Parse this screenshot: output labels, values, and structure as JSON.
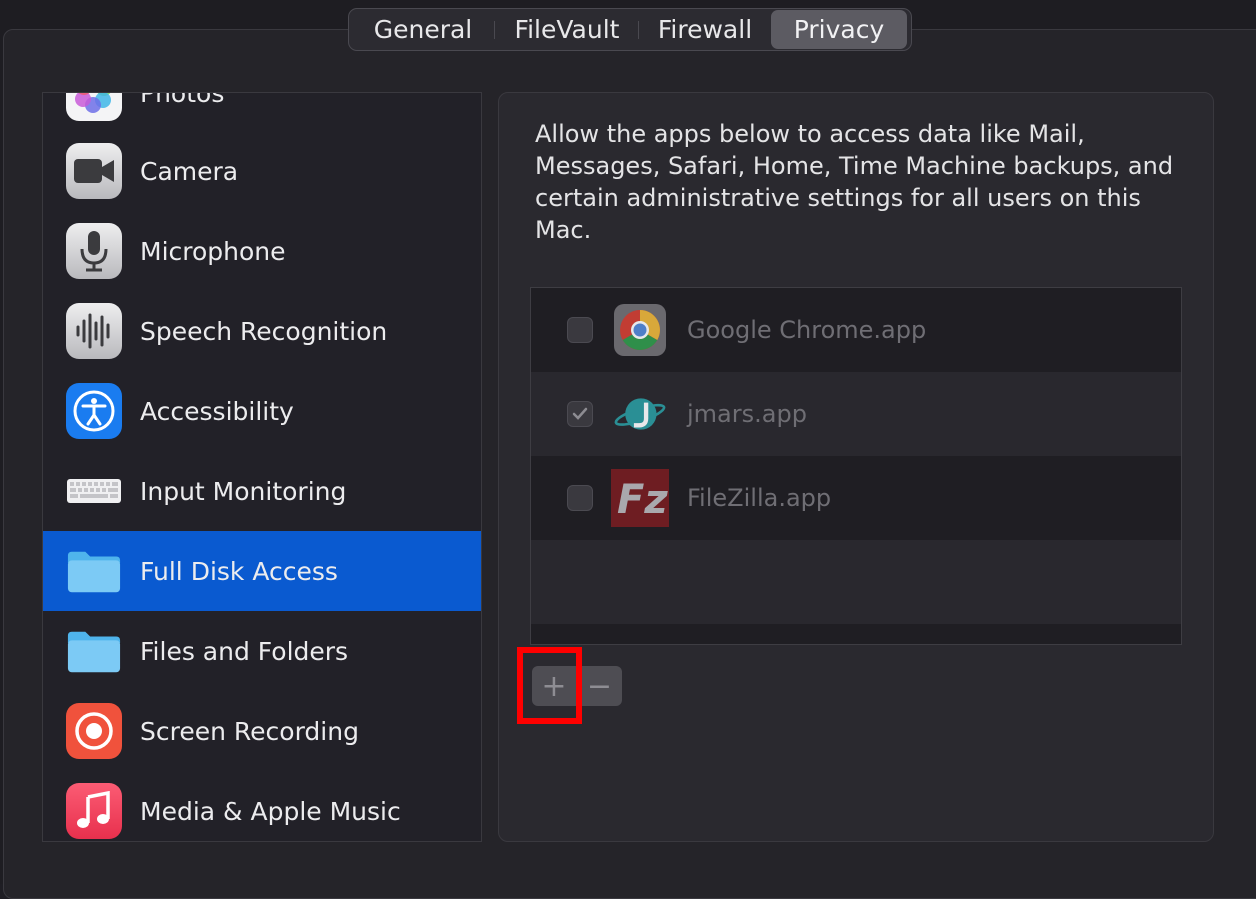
{
  "tabs": [
    {
      "label": "General",
      "active": false
    },
    {
      "label": "FileVault",
      "active": false
    },
    {
      "label": "Firewall",
      "active": false
    },
    {
      "label": "Privacy",
      "active": true
    }
  ],
  "sidebar": {
    "items": [
      {
        "label": "Photos",
        "icon": "photos-icon"
      },
      {
        "label": "Camera",
        "icon": "camera-icon"
      },
      {
        "label": "Microphone",
        "icon": "microphone-icon"
      },
      {
        "label": "Speech Recognition",
        "icon": "waveform-icon"
      },
      {
        "label": "Accessibility",
        "icon": "accessibility-icon"
      },
      {
        "label": "Input Monitoring",
        "icon": "keyboard-icon"
      },
      {
        "label": "Full Disk Access",
        "icon": "folder-icon",
        "selected": true
      },
      {
        "label": "Files and Folders",
        "icon": "folder-icon"
      },
      {
        "label": "Screen Recording",
        "icon": "record-icon"
      },
      {
        "label": "Media & Apple Music",
        "icon": "music-note-icon"
      }
    ]
  },
  "main": {
    "description": "Allow the apps below to access data like Mail, Messages, Safari, Home, Time Machine backups, and certain administrative settings for all users on this Mac.",
    "apps": [
      {
        "name": "Google Chrome.app",
        "checked": false,
        "icon": "chrome-icon"
      },
      {
        "name": "jmars.app",
        "checked": true,
        "icon": "jmars-icon"
      },
      {
        "name": "FileZilla.app",
        "checked": false,
        "icon": "filezilla-icon"
      }
    ],
    "add_label": "+",
    "remove_label": "−"
  },
  "colors": {
    "selection": "#0a5ad0",
    "highlight": "#ff0000"
  }
}
